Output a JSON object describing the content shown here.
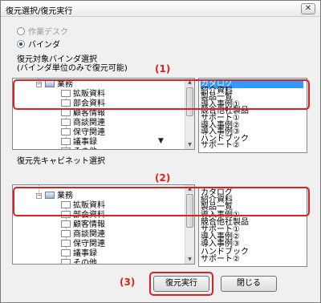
{
  "window": {
    "title": "復元選択/復元実行",
    "close_glyph": "✕"
  },
  "radio": {
    "workdesk_label": "作業デスク",
    "binder_label": "バインダ"
  },
  "source": {
    "label_line1": "復元対象バインダ選択",
    "label_line2": "(バインダ単位のみで復元可能)",
    "tree": [
      {
        "text": "業務",
        "level": 0,
        "kind": "folder"
      },
      {
        "text": "拡販資料",
        "level": 1,
        "kind": "doc"
      },
      {
        "text": "部会資料",
        "level": 1,
        "kind": "doc"
      },
      {
        "text": "顧客情報",
        "level": 1,
        "kind": "doc"
      },
      {
        "text": "商談関連",
        "level": 1,
        "kind": "doc"
      },
      {
        "text": "保守関連",
        "level": 1,
        "kind": "doc"
      },
      {
        "text": "議事録",
        "level": 1,
        "kind": "doc"
      },
      {
        "text": "その他",
        "level": 1,
        "kind": "doc"
      }
    ],
    "list": [
      "カタログ",
      "紹介資料",
      "製品一覧",
      "導入事例①",
      "競合他社製品",
      "サポート①",
      "導入事例②",
      "導入事例③",
      "ハンドブック",
      "サポート②"
    ],
    "selected_index": 0
  },
  "arrow_glyph": "▼",
  "target": {
    "label": "復元先キャビネット選択",
    "tree": [
      {
        "text": "業務",
        "level": 0,
        "kind": "folder"
      },
      {
        "text": "拡販資料",
        "level": 1,
        "kind": "doc"
      },
      {
        "text": "部会資料",
        "level": 1,
        "kind": "doc"
      },
      {
        "text": "顧客情報",
        "level": 1,
        "kind": "doc"
      },
      {
        "text": "商談関連",
        "level": 1,
        "kind": "doc"
      },
      {
        "text": "保守関連",
        "level": 1,
        "kind": "doc"
      },
      {
        "text": "議事録",
        "level": 1,
        "kind": "doc"
      },
      {
        "text": "その他",
        "level": 1,
        "kind": "doc"
      }
    ],
    "list": [
      "カタログ",
      "紹介資料",
      "製品一覧",
      "導入事例①",
      "競合他社製品",
      "サポート①",
      "導入事例②",
      "導入事例③",
      "ハンドブック",
      "サポート②"
    ]
  },
  "callouts": {
    "c1": "(1)",
    "c2": "(2)",
    "c3": "(3)"
  },
  "buttons": {
    "restore": "復元実行",
    "close": "閉じる"
  }
}
